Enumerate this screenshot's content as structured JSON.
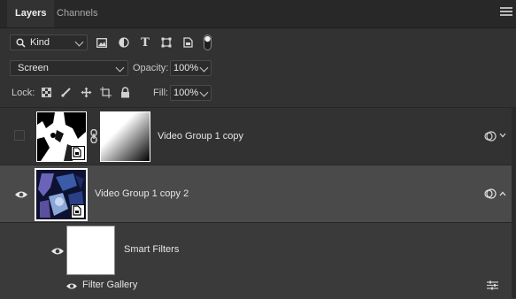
{
  "tabs": [
    {
      "label": "Layers",
      "active": true
    },
    {
      "label": "Channels",
      "active": false
    }
  ],
  "filter": {
    "kind_label": "Kind"
  },
  "blend": {
    "mode": "Screen",
    "opacity_label": "Opacity:",
    "opacity_value": "100%"
  },
  "lock": {
    "label": "Lock:",
    "fill_label": "Fill:",
    "fill_value": "100%"
  },
  "layers": [
    {
      "name": "Video Group 1 copy",
      "visible": false,
      "selected": false
    },
    {
      "name": "Video Group 1 copy 2",
      "visible": true,
      "selected": true
    },
    {
      "name": "Smart Filters",
      "visible": true
    },
    {
      "name": "Filter Gallery",
      "visible": true
    }
  ],
  "colors": {
    "panel": "#323232",
    "selected_row": "#4a4a4a",
    "accent": "#ffffff"
  }
}
